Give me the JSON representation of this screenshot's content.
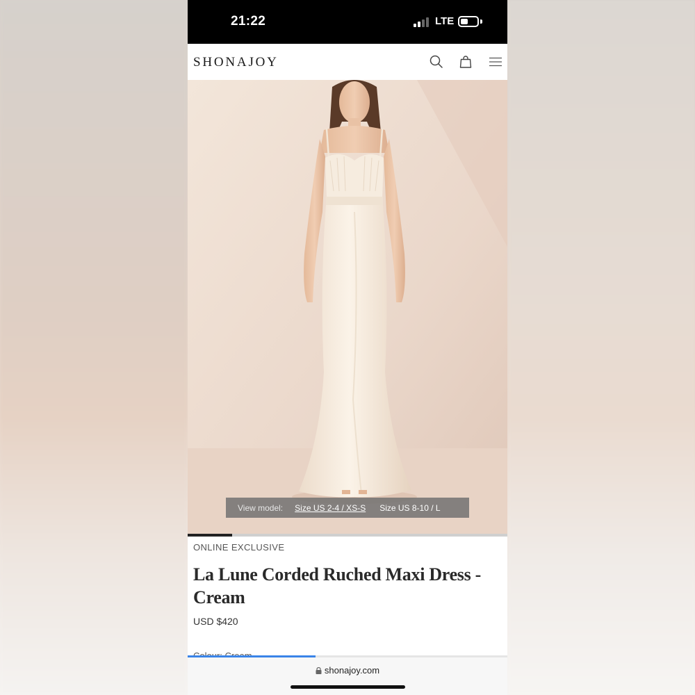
{
  "status_bar": {
    "time": "21:22",
    "network": "LTE"
  },
  "header": {
    "logo": "SHONAJOY",
    "icons": [
      "search-icon",
      "bag-icon",
      "menu-icon"
    ]
  },
  "hero": {
    "view_model_label": "View model:",
    "model_options": [
      "Size US 2-4 / XS-S",
      "Size US 8-10 / L"
    ],
    "active_option_index": 0
  },
  "carousel": {
    "progress_fraction": 0.14
  },
  "product": {
    "badge": "ONLINE EXCLUSIVE",
    "title": "La Lune Corded Ruched Maxi Dress - Cream",
    "price": "USD $420",
    "colour": "Colour: Cream"
  },
  "browser": {
    "url": "shonajoy.com",
    "load_progress_fraction": 0.4
  },
  "colors": {
    "status_bar": "#000000",
    "load_progress": "#3a84e8",
    "hero_background": "#eddccf"
  }
}
